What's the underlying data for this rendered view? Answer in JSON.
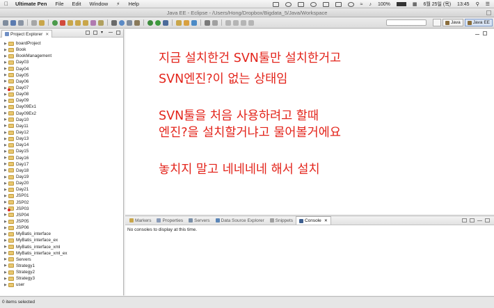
{
  "menubar": {
    "app_name": "Ultimate Pen",
    "items": [
      "File",
      "Edit",
      "Window",
      "Help"
    ],
    "battery": "100%",
    "date": "6월 25일 (목)",
    "time": "13:45"
  },
  "window": {
    "title": "Java EE - Eclipse - /Users/Hong/Dropbox/Bigdata_5/Java/Workspace"
  },
  "perspectives": [
    {
      "label": "Java",
      "active": false
    },
    {
      "label": "Java EE",
      "active": true
    }
  ],
  "explorer": {
    "tab_label": "Project Explorer",
    "close_glyph": "✕",
    "projects": [
      {
        "name": "boardProject",
        "error": false
      },
      {
        "name": "Book",
        "error": false
      },
      {
        "name": "BookManagement",
        "error": false
      },
      {
        "name": "Day03",
        "error": false
      },
      {
        "name": "Day04",
        "error": false
      },
      {
        "name": "Day05",
        "error": false
      },
      {
        "name": "Day06",
        "error": false
      },
      {
        "name": "Day07",
        "error": true
      },
      {
        "name": "Day08",
        "error": false
      },
      {
        "name": "Day09",
        "error": false
      },
      {
        "name": "Day09Ex1",
        "error": false
      },
      {
        "name": "Day09Ex2",
        "error": false
      },
      {
        "name": "Day10",
        "error": false
      },
      {
        "name": "Day11",
        "error": false
      },
      {
        "name": "Day12",
        "error": false
      },
      {
        "name": "Day13",
        "error": false
      },
      {
        "name": "Day14",
        "error": false
      },
      {
        "name": "Day15",
        "error": false
      },
      {
        "name": "Day16",
        "error": false
      },
      {
        "name": "Day17",
        "error": false
      },
      {
        "name": "Day18",
        "error": false
      },
      {
        "name": "Day19",
        "error": false
      },
      {
        "name": "Day20",
        "error": false
      },
      {
        "name": "Day21",
        "error": false
      },
      {
        "name": "JSP01",
        "error": false
      },
      {
        "name": "JSP02",
        "error": false
      },
      {
        "name": "JSP03",
        "error": true
      },
      {
        "name": "JSP04",
        "error": false
      },
      {
        "name": "JSP05",
        "error": false
      },
      {
        "name": "JSP06",
        "error": false
      },
      {
        "name": "MyBatis_interface",
        "error": false
      },
      {
        "name": "MyBatis_interface_ex",
        "error": false
      },
      {
        "name": "MyBatis_interface_xml",
        "error": false
      },
      {
        "name": "MyBatis_interface_xml_ex",
        "error": false
      },
      {
        "name": "Servers",
        "error": false
      },
      {
        "name": "Strategy1",
        "error": false
      },
      {
        "name": "Strategy2",
        "error": false
      },
      {
        "name": "Strategy3",
        "error": false
      },
      {
        "name": "user",
        "error": false
      }
    ]
  },
  "annotation": {
    "lines": [
      "지금 설치한건 SVN툴만 설치한거고",
      "SVN엔진?이 없는 상태임",
      "SVN툴을 처음 사용하려고 할때",
      "엔진?을 설치할거냐고 물어볼거에요",
      "놓치지 말고 네네네네 해서 설치"
    ],
    "color": "#e3241b"
  },
  "bottom_panel": {
    "tabs": [
      {
        "label": "Markers",
        "active": false,
        "icon_color": "#c9a64a"
      },
      {
        "label": "Properties",
        "active": false,
        "icon_color": "#8a9bb8"
      },
      {
        "label": "Servers",
        "active": false,
        "icon_color": "#7a8fa8"
      },
      {
        "label": "Data Source Explorer",
        "active": false,
        "icon_color": "#5b86b8"
      },
      {
        "label": "Snippets",
        "active": false,
        "icon_color": "#a0a0a0"
      },
      {
        "label": "Console",
        "active": true,
        "icon_color": "#3d5f8f"
      }
    ],
    "close_glyph": "✕",
    "console_message": "No consoles to display at this time."
  },
  "statusbar": {
    "text": "0 items selected"
  }
}
